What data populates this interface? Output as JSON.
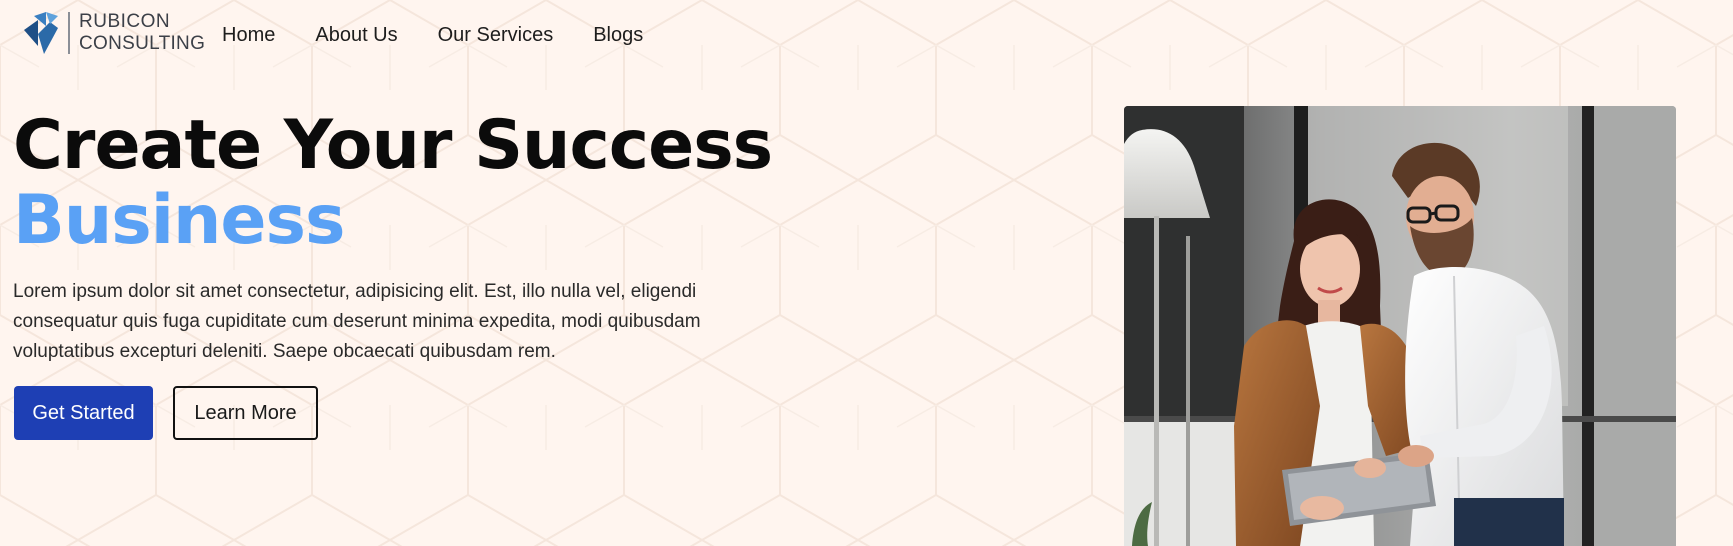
{
  "brand": {
    "name_line1": "RUBICON",
    "name_line2": "CONSULTING"
  },
  "nav": {
    "items": [
      {
        "label": "Home"
      },
      {
        "label": "About Us"
      },
      {
        "label": "Our Services"
      },
      {
        "label": "Blogs"
      }
    ]
  },
  "hero": {
    "title_line1": "Create Your Success",
    "title_line2": "Business",
    "description": "Lorem ipsum dolor sit amet consectetur, adipisicing elit. Est, illo nulla vel, eligendi consequatur quis fuga cupiditate cum deserunt minima expedita, modi quibusdam voluptatibus excepturi deleniti. Saepe obcaecati quibusdam rem.",
    "primary_button": "Get Started",
    "secondary_button": "Learn More"
  },
  "colors": {
    "page_background": "#fff5ef",
    "accent_blue": "#5aa1f5",
    "primary_button": "#1e3fb4",
    "heading": "#0b0b0b"
  },
  "icons": {
    "logo": "rubicon-logo-icon"
  },
  "images": {
    "hero": "business-team-photo"
  }
}
